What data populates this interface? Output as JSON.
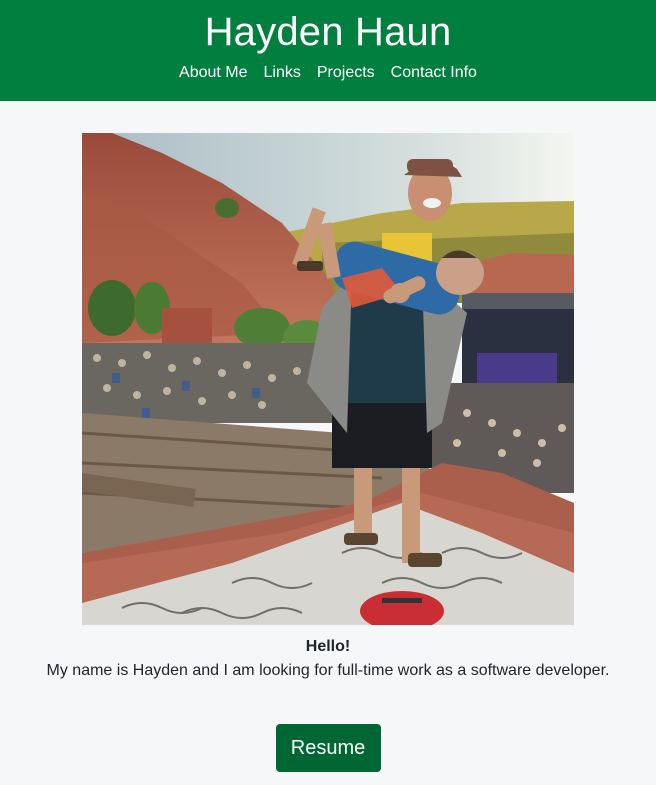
{
  "header": {
    "title": "Hayden Haun",
    "nav": [
      {
        "label": "About Me"
      },
      {
        "label": "Links"
      },
      {
        "label": "Projects"
      },
      {
        "label": "Contact Info"
      }
    ]
  },
  "main": {
    "greeting": "Hello!",
    "intro": "My name is Hayden and I am looking for full-time work as a software developer.",
    "resume_label": "Resume"
  },
  "colors": {
    "header_bg": "#017f3f",
    "button_bg": "#006633",
    "page_bg": "#f5f7f9"
  }
}
